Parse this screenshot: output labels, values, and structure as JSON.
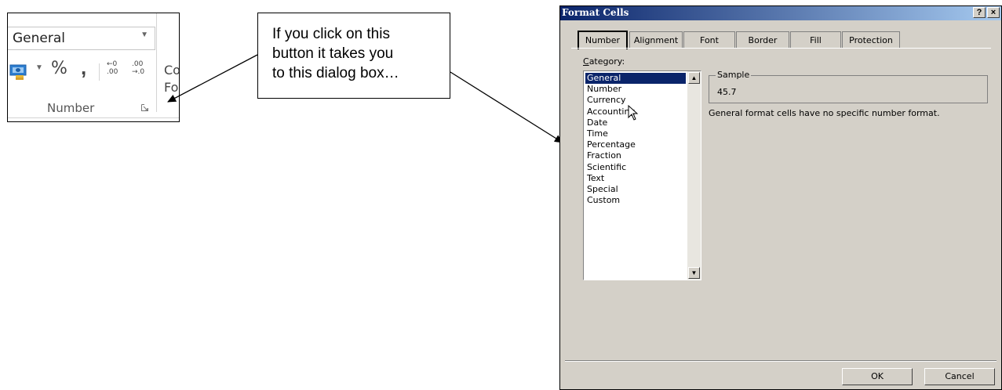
{
  "ribbon": {
    "format_value": "General",
    "percent_symbol": "%",
    "comma_symbol": ",",
    "increase_decimal_top": "←0",
    "increase_decimal_bottom": ".00",
    "decrease_decimal_top": ".00",
    "decrease_decimal_bottom": "→.0",
    "conditional_partial_1": "Co",
    "conditional_partial_2": "Fo",
    "group_label": "Number"
  },
  "callout": {
    "text": "If you click on this\nbutton it takes you\nto this dialog box…"
  },
  "dialog": {
    "title": "Format Cells",
    "help_button": "?",
    "close_button": "×",
    "tabs": [
      {
        "label": "Number",
        "active": true
      },
      {
        "label": "Alignment",
        "active": false
      },
      {
        "label": "Font",
        "active": false
      },
      {
        "label": "Border",
        "active": false
      },
      {
        "label": "Fill",
        "active": false
      },
      {
        "label": "Protection",
        "active": false
      }
    ],
    "category_label_underlined": "C",
    "category_label_rest": "ategory:",
    "categories": [
      "General",
      "Number",
      "Currency",
      "Accounting",
      "Date",
      "Time",
      "Percentage",
      "Fraction",
      "Scientific",
      "Text",
      "Special",
      "Custom"
    ],
    "selected_category": "General",
    "sample_label": "Sample",
    "sample_value": "45.7",
    "description": "General format cells have no specific number format.",
    "ok_label": "OK",
    "cancel_label": "Cancel"
  },
  "colors": {
    "title_bar_start": "#0a246a",
    "title_bar_end": "#a6caf0",
    "dialog_face": "#d4d0c8",
    "selection": "#0a246a"
  }
}
